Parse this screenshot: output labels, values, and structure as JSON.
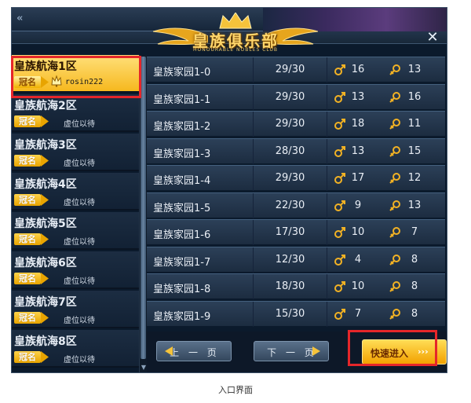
{
  "header": {
    "back_glyph": "«",
    "title": "皇族俱乐部",
    "subtitle": "HONOURABLE NOBLES CLUB",
    "close_glyph": "✕"
  },
  "servers": [
    {
      "name": "皇族航海1区",
      "badge": "冠名",
      "status": "rosin222",
      "active": true
    },
    {
      "name": "皇族航海2区",
      "badge": "冠名",
      "status": "虚位以待",
      "active": false
    },
    {
      "name": "皇族航海3区",
      "badge": "冠名",
      "status": "虚位以待",
      "active": false
    },
    {
      "name": "皇族航海4区",
      "badge": "冠名",
      "status": "虚位以待",
      "active": false
    },
    {
      "name": "皇族航海5区",
      "badge": "冠名",
      "status": "虚位以待",
      "active": false
    },
    {
      "name": "皇族航海6区",
      "badge": "冠名",
      "status": "虚位以待",
      "active": false
    },
    {
      "name": "皇族航海7区",
      "badge": "冠名",
      "status": "虚位以待",
      "active": false
    },
    {
      "name": "皇族航海8区",
      "badge": "冠名",
      "status": "虚位以待",
      "active": false
    }
  ],
  "rooms": [
    {
      "name": "皇族家园1-0",
      "capacity": "29/30",
      "male": "16",
      "female": "13"
    },
    {
      "name": "皇族家园1-1",
      "capacity": "29/30",
      "male": "13",
      "female": "16"
    },
    {
      "name": "皇族家园1-2",
      "capacity": "29/30",
      "male": "18",
      "female": "11"
    },
    {
      "name": "皇族家园1-3",
      "capacity": "28/30",
      "male": "13",
      "female": "15"
    },
    {
      "name": "皇族家园1-4",
      "capacity": "29/30",
      "male": "17",
      "female": "12"
    },
    {
      "name": "皇族家园1-5",
      "capacity": "22/30",
      "male": "9",
      "female": "13"
    },
    {
      "name": "皇族家园1-6",
      "capacity": "17/30",
      "male": "10",
      "female": "7"
    },
    {
      "name": "皇族家园1-7",
      "capacity": "12/30",
      "male": "4",
      "female": "8"
    },
    {
      "name": "皇族家园1-8",
      "capacity": "18/30",
      "male": "10",
      "female": "8"
    },
    {
      "name": "皇族家园1-9",
      "capacity": "15/30",
      "male": "7",
      "female": "8"
    }
  ],
  "buttons": {
    "prev": "上 一 页",
    "next": "下 一 页",
    "enter": "快速进入",
    "enter_more": "›››"
  },
  "caption": "入口界面",
  "colors": {
    "accent_gold": "#f6b81e",
    "highlight_red": "#e5262a",
    "panel_bg": "#0b1a2c"
  }
}
